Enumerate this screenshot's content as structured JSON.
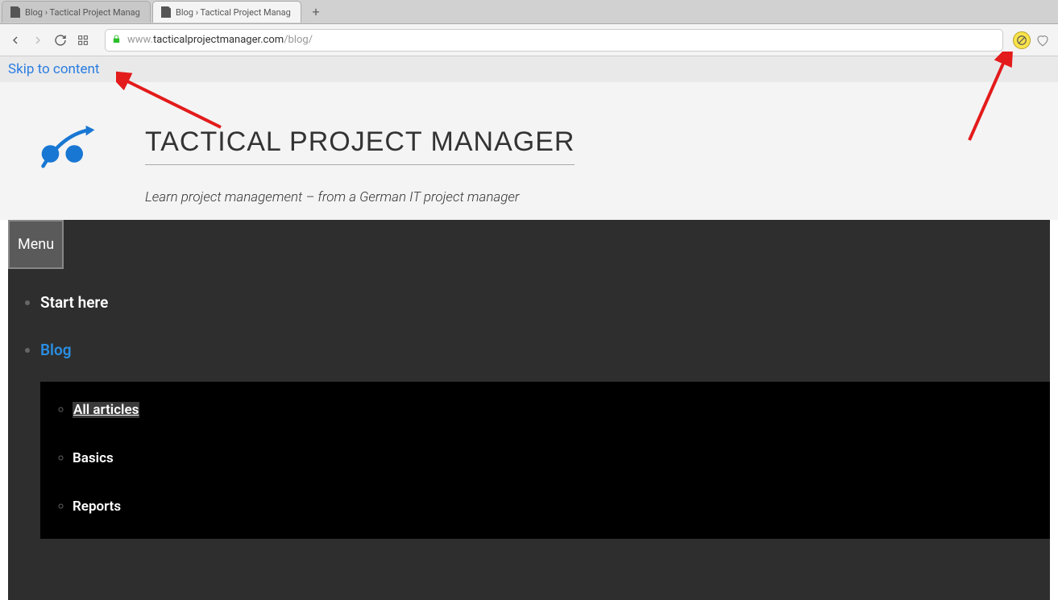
{
  "browser": {
    "tabs": [
      {
        "title": "Blog › Tactical Project Manag",
        "active": false
      },
      {
        "title": "Blog › Tactical Project Manag",
        "active": true
      }
    ],
    "address": {
      "prefix": "www.",
      "domain": "tacticalprojectmanager.com",
      "path": "/blog/"
    }
  },
  "page": {
    "skip_link": "Skip to content",
    "site_title": "TACTICAL PROJECT MANAGER",
    "tagline": "Learn project management – from a German IT project manager",
    "menu_button": "Menu",
    "nav": {
      "items": [
        {
          "label": "Start here",
          "active": false
        },
        {
          "label": "Blog",
          "active": true
        }
      ],
      "submenu": [
        {
          "label": "All articles",
          "current": true
        },
        {
          "label": "Basics",
          "current": false
        },
        {
          "label": "Reports",
          "current": false
        }
      ]
    }
  },
  "colors": {
    "link_blue": "#2a7de1",
    "logo_blue": "#1877d3",
    "arrow_red": "#e31b1b"
  }
}
